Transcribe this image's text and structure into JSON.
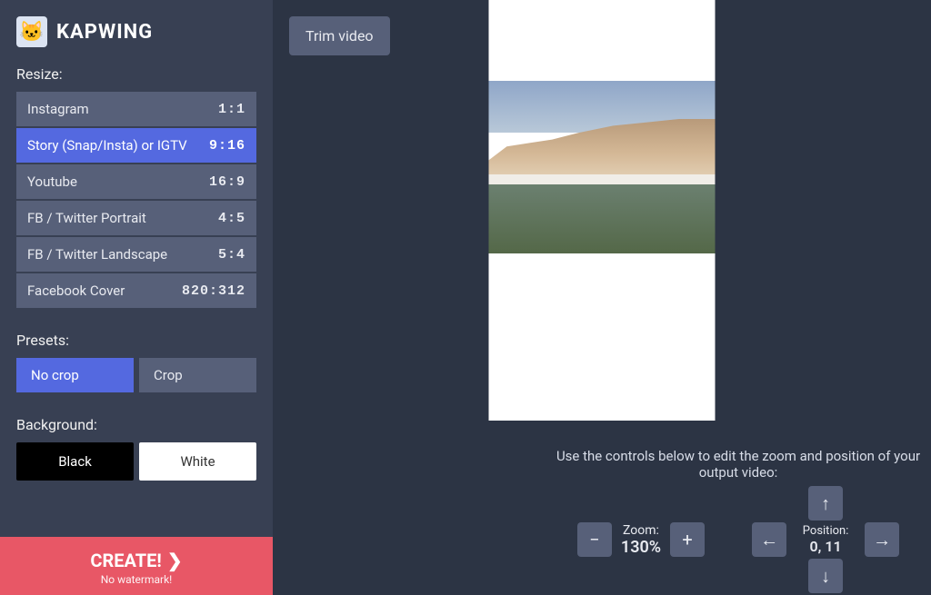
{
  "app": {
    "name": "KAPWING",
    "logo_glyph": "🐱"
  },
  "sidebar": {
    "resize_label": "Resize:",
    "ratios": [
      {
        "label": "Instagram",
        "ratio": "1:1",
        "selected": false
      },
      {
        "label": "Story (Snap/Insta) or IGTV",
        "ratio": "9:16",
        "selected": true
      },
      {
        "label": "Youtube",
        "ratio": "16:9",
        "selected": false
      },
      {
        "label": "FB / Twitter Portrait",
        "ratio": "4:5",
        "selected": false
      },
      {
        "label": "FB / Twitter Landscape",
        "ratio": "5:4",
        "selected": false
      },
      {
        "label": "Facebook Cover",
        "ratio": "820:312",
        "selected": false
      }
    ],
    "presets_label": "Presets:",
    "presets": [
      {
        "label": "No crop",
        "selected": true
      },
      {
        "label": "Crop",
        "selected": false
      }
    ],
    "background_label": "Background:",
    "backgrounds": [
      {
        "label": "Black",
        "value": "#000000"
      },
      {
        "label": "White",
        "value": "#ffffff"
      }
    ]
  },
  "create": {
    "main": "CREATE!",
    "sub": "No watermark!"
  },
  "main": {
    "trim_label": "Trim video",
    "hint": "Use the controls below to edit the zoom and position of your output video:",
    "zoom": {
      "label": "Zoom:",
      "value": "130%"
    },
    "position": {
      "label": "Position:",
      "value": "0, 11"
    },
    "icons": {
      "minus": "−",
      "plus": "+",
      "left": "←",
      "right": "→",
      "up": "↑",
      "down": "↓",
      "chevron": "❯"
    }
  },
  "colors": {
    "bg_main": "#2c3444",
    "bg_sidebar": "#384053",
    "bg_item": "#576079",
    "bg_selected": "#5469e0",
    "create": "#e85766"
  }
}
